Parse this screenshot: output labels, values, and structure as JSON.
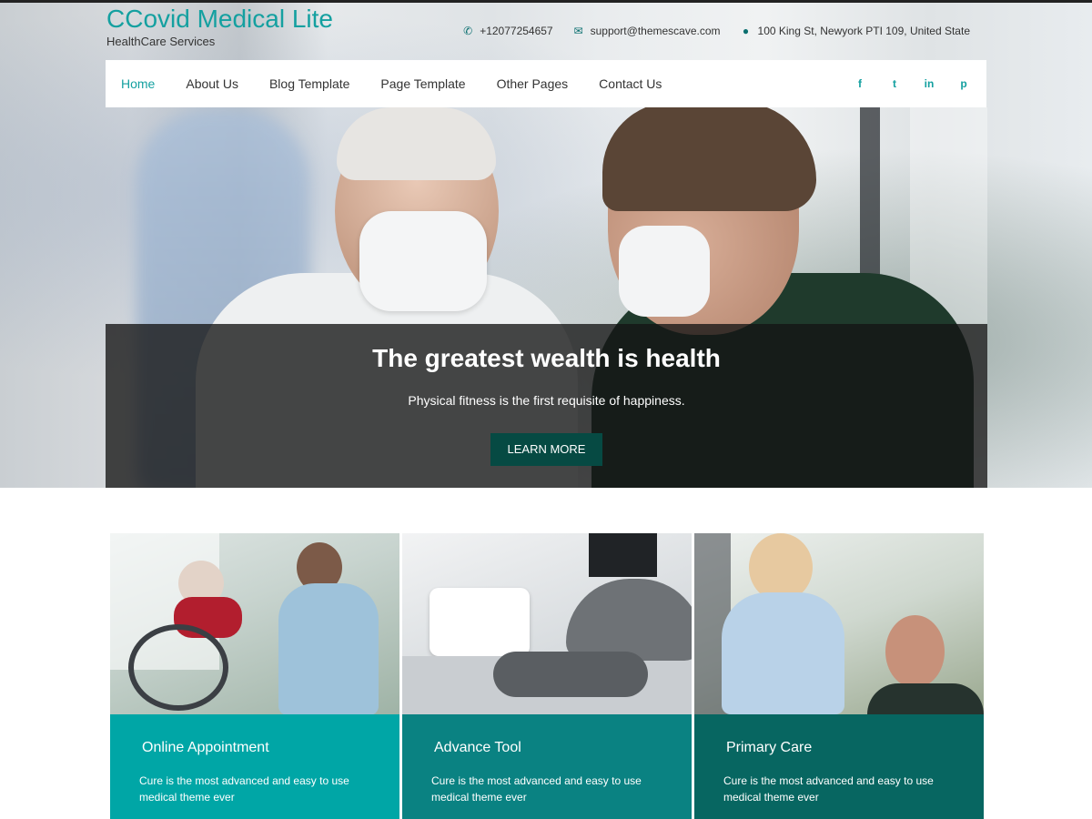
{
  "brand": {
    "title": "CCovid Medical Lite",
    "tagline": "HealthCare Services"
  },
  "contacts": {
    "phone": "+12077254657",
    "email": "support@themescave.com",
    "address": "100 King St, Newyork PTI 109, United State"
  },
  "nav": {
    "items": [
      {
        "label": "Home",
        "active": true
      },
      {
        "label": "About Us"
      },
      {
        "label": "Blog Template"
      },
      {
        "label": "Page Template"
      },
      {
        "label": "Other Pages"
      },
      {
        "label": "Contact Us"
      }
    ],
    "social": [
      {
        "name": "facebook-icon",
        "glyph": "f"
      },
      {
        "name": "twitter-icon",
        "glyph": "t"
      },
      {
        "name": "linkedin-icon",
        "glyph": "in"
      },
      {
        "name": "pinterest-icon",
        "glyph": "p"
      }
    ]
  },
  "hero": {
    "heading": "The greatest wealth is health",
    "subtext": "Physical fitness is the first requisite of happiness.",
    "button_label": "LEARN MORE"
  },
  "cards": [
    {
      "title": "Online Appointment",
      "text": "Cure is the most advanced and easy to use medical theme ever",
      "image": "wheelchair-patient-photo"
    },
    {
      "title": "Advance Tool",
      "text": "Cure is the most advanced and easy to use medical theme ever",
      "image": "dental-equipment-photo"
    },
    {
      "title": "Primary Care",
      "text": "Cure is the most advanced and easy to use medical theme ever",
      "image": "swab-test-photo"
    }
  ],
  "colors": {
    "accent": "#14a0a0",
    "button": "#064a43",
    "card1": "#00a6a6",
    "card2": "#0a8282",
    "card3": "#076661"
  }
}
